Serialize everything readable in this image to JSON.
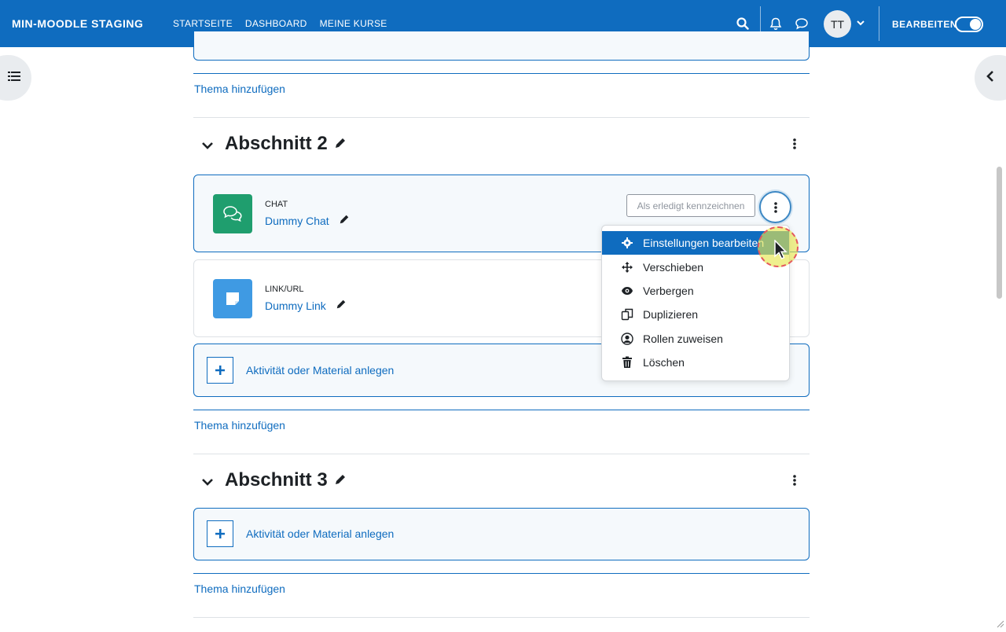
{
  "navbar": {
    "brand": "MIN-MOODLE STAGING",
    "links": [
      "STARTSEITE",
      "DASHBOARD",
      "MEINE KURSE"
    ],
    "active_link": "MEINE KURSE",
    "avatar_initials": "TT",
    "edit_mode_label": "BEARBEITEN",
    "edit_mode_on": true,
    "brand_color": "#0f6cbf"
  },
  "add_topic_label": "Thema hinzufügen",
  "add_activity_label": "Aktivität oder Material anlegen",
  "sections": [
    {
      "title": "Abschnitt 2",
      "activities": [
        {
          "type": "CHAT",
          "name": "Dummy Chat",
          "icon": "chat-icon",
          "icon_color": "#1f9e6e"
        },
        {
          "type": "LINK/URL",
          "name": "Dummy Link",
          "icon": "url-icon",
          "icon_color": "#3f9ae3"
        }
      ]
    },
    {
      "title": "Abschnitt 3",
      "activities": []
    }
  ],
  "completion_button": "Als erledigt kennzeichnen",
  "action_menu": {
    "items": [
      {
        "label": "Einstellungen bearbeiten",
        "icon": "gear-icon",
        "active": true
      },
      {
        "label": "Verschieben",
        "icon": "move-icon",
        "active": false
      },
      {
        "label": "Verbergen",
        "icon": "eye-icon",
        "active": false
      },
      {
        "label": "Duplizieren",
        "icon": "copy-icon",
        "active": false
      },
      {
        "label": "Rollen zuweisen",
        "icon": "user-circle-icon",
        "active": false
      },
      {
        "label": "Löschen",
        "icon": "trash-icon",
        "active": false
      }
    ]
  }
}
